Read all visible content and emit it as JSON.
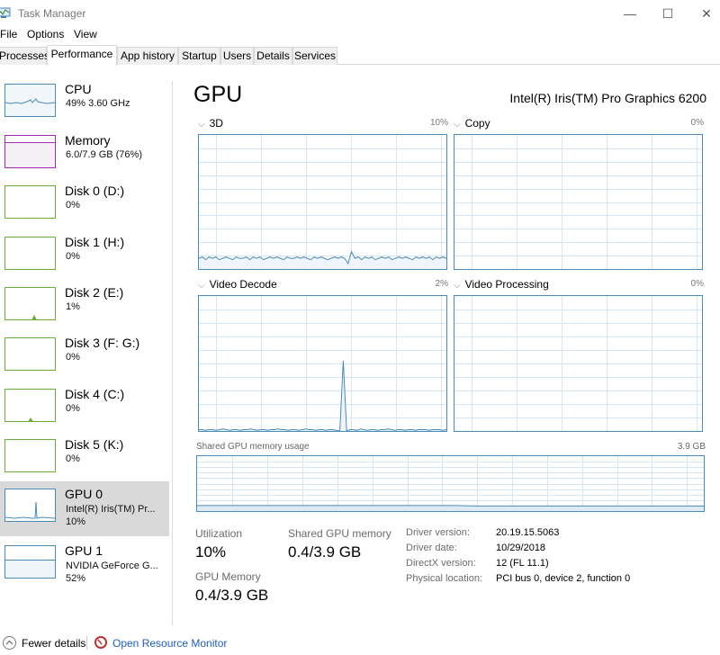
{
  "window": {
    "title": "Task Manager",
    "controls": {
      "minimize": "—",
      "maximize": "☐",
      "close": "✕"
    }
  },
  "menu": [
    "File",
    "Options",
    "View"
  ],
  "tabs": [
    {
      "label": "Processes",
      "active": false
    },
    {
      "label": "Performance",
      "active": true
    },
    {
      "label": "App history",
      "active": false
    },
    {
      "label": "Startup",
      "active": false
    },
    {
      "label": "Users",
      "active": false
    },
    {
      "label": "Details",
      "active": false
    },
    {
      "label": "Services",
      "active": false
    }
  ],
  "sidebar": {
    "items": [
      {
        "name": "CPU",
        "line1": "49% 3.60 GHz",
        "line2": "",
        "color": "#4a8bb8",
        "utilization": 49,
        "selected": false
      },
      {
        "name": "Memory",
        "line1": "6.0/7.9 GB (76%)",
        "line2": "",
        "color": "#a02cb0",
        "utilization": 76,
        "selected": false
      },
      {
        "name": "Disk 0 (D:)",
        "line1": "0%",
        "line2": "",
        "color": "#6aae3a",
        "utilization": 0,
        "selected": false
      },
      {
        "name": "Disk 1 (H:)",
        "line1": "0%",
        "line2": "",
        "color": "#6aae3a",
        "utilization": 0,
        "selected": false
      },
      {
        "name": "Disk 2 (E:)",
        "line1": "1%",
        "line2": "",
        "color": "#6aae3a",
        "utilization": 1,
        "selected": false
      },
      {
        "name": "Disk 3 (F: G:)",
        "line1": "0%",
        "line2": "",
        "color": "#6aae3a",
        "utilization": 0,
        "selected": false
      },
      {
        "name": "Disk 4 (C:)",
        "line1": "0%",
        "line2": "",
        "color": "#6aae3a",
        "utilization": 0,
        "selected": false
      },
      {
        "name": "Disk 5 (K:)",
        "line1": "0%",
        "line2": "",
        "color": "#6aae3a",
        "utilization": 0,
        "selected": false
      },
      {
        "name": "GPU 0",
        "line1": "Intel(R) Iris(TM) Pr...",
        "line2": "10%",
        "color": "#4a8bb8",
        "utilization": 10,
        "selected": true
      },
      {
        "name": "GPU 1",
        "line1": "NVIDIA GeForce G...",
        "line2": "52%",
        "color": "#4a8bb8",
        "utilization": 52,
        "selected": false
      }
    ]
  },
  "main": {
    "title": "GPU",
    "model": "Intel(R) Iris(TM) Pro Graphics 6200",
    "engines": [
      {
        "label": "3D",
        "percent": "10%"
      },
      {
        "label": "Copy",
        "percent": "0%"
      },
      {
        "label": "Video Decode",
        "percent": "2%"
      },
      {
        "label": "Video Processing",
        "percent": "0%"
      }
    ],
    "shared_memory_graph": {
      "label": "Shared GPU memory usage",
      "max": "3.9 GB"
    },
    "stats": {
      "utilization_label": "Utilization",
      "utilization_value": "10%",
      "shared_label": "Shared GPU memory",
      "shared_value": "0.4/3.9 GB",
      "gpu_memory_label": "GPU Memory",
      "gpu_memory_value": "0.4/3.9 GB"
    },
    "info": [
      {
        "label": "Driver version:",
        "value": "20.19.15.5063"
      },
      {
        "label": "Driver date:",
        "value": "10/29/2018"
      },
      {
        "label": "DirectX version:",
        "value": "12 (FL 11.1)"
      },
      {
        "label": "Physical location:",
        "value": "PCI bus 0, device 2, function 0"
      }
    ]
  },
  "footer": {
    "fewer_details": "Fewer details",
    "open_resource_monitor": "Open Resource Monitor"
  },
  "graph_series": {
    "3d": [
      8,
      9,
      7,
      9,
      8,
      9,
      7,
      8,
      9,
      8,
      7,
      9,
      8,
      8,
      9,
      7,
      9,
      8,
      9,
      7,
      8,
      9,
      8,
      9,
      8,
      7,
      9,
      8,
      8,
      9,
      8,
      9,
      8,
      7,
      9,
      8,
      9,
      8,
      7,
      8,
      9,
      8,
      9,
      8,
      4,
      13,
      8,
      9,
      7,
      9,
      8,
      9,
      7,
      8,
      9,
      8,
      9,
      7,
      8,
      9,
      8,
      9,
      8,
      7,
      9,
      8,
      9,
      8,
      9,
      7,
      9,
      8,
      9,
      8
    ],
    "video_decode": [
      1,
      1,
      0.5,
      1,
      1,
      0.5,
      1,
      1.5,
      1,
      0.5,
      1,
      1,
      0.5,
      1,
      1,
      1.5,
      1,
      0.5,
      1,
      1,
      0.5,
      1,
      1,
      1.5,
      1,
      1,
      0.5,
      1,
      1,
      0.5,
      1,
      1.5,
      1,
      1,
      0.5,
      1,
      1,
      0.5,
      1,
      1,
      0.5,
      0,
      52,
      0,
      1,
      1,
      0.5,
      1.5,
      1,
      0.5,
      1,
      1,
      0.5,
      1,
      1,
      1.5,
      1,
      0.5,
      1,
      1,
      0.5,
      1,
      1,
      0.5,
      1,
      1,
      1,
      0.5,
      1,
      1,
      1,
      0.5,
      1
    ],
    "shared_memory": [
      10,
      10,
      10,
      10,
      10,
      10,
      10,
      10,
      10,
      10,
      10,
      10,
      10,
      10,
      10,
      10,
      10,
      10,
      10,
      10,
      10,
      10,
      10,
      10,
      10,
      10,
      9.6,
      9.2,
      9.2,
      9.2,
      9.2,
      9.2,
      9.2,
      9.2,
      9.2,
      9.2,
      9.2,
      9.2,
      9.2,
      9.2,
      9.2,
      9.2,
      9.2,
      9.2,
      9.2,
      9.2,
      9.2,
      9.2,
      9.2,
      9.2
    ]
  }
}
